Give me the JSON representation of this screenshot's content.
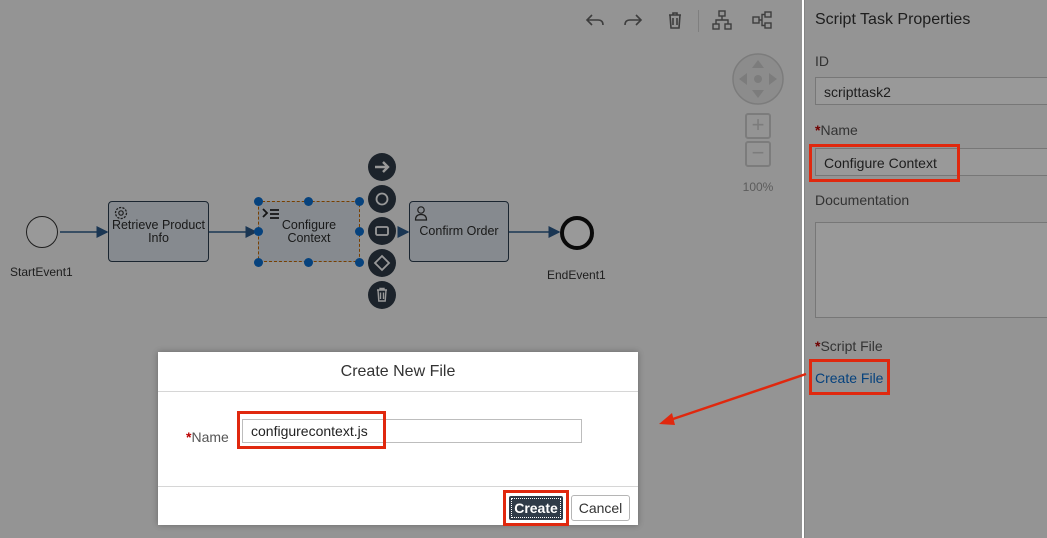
{
  "toolbar": {
    "icons": [
      "undo-icon",
      "redo-icon",
      "delete-icon",
      "auto-layout-icon",
      "horizontal-layout-icon"
    ]
  },
  "navigator": {
    "zoom_in": "+",
    "zoom_out": "−",
    "zoom_level": "100%"
  },
  "diagram": {
    "start_event_label": "StartEvent1",
    "end_event_label": "EndEvent1",
    "task1_label": "Retrieve Product Info",
    "task2_label": "Configure Context",
    "task3_label": "Confirm Order"
  },
  "properties": {
    "title": "Script Task Properties",
    "id_label": "ID",
    "id_value": "scripttask2",
    "name_label": "Name",
    "name_value": "Configure Context",
    "documentation_label": "Documentation",
    "documentation_value": "",
    "script_file_label": "Script File",
    "create_file_link": "Create File",
    "required_marker": "*"
  },
  "dialog": {
    "title": "Create New File",
    "name_label": "Name",
    "name_value": "configurecontext.js",
    "create_button": "Create",
    "cancel_button": "Cancel"
  },
  "colors": {
    "highlight": "#e0280e",
    "primary_button": "#2f3b48",
    "link": "#0a6ed1",
    "task_fill": "#dfe7ef"
  }
}
